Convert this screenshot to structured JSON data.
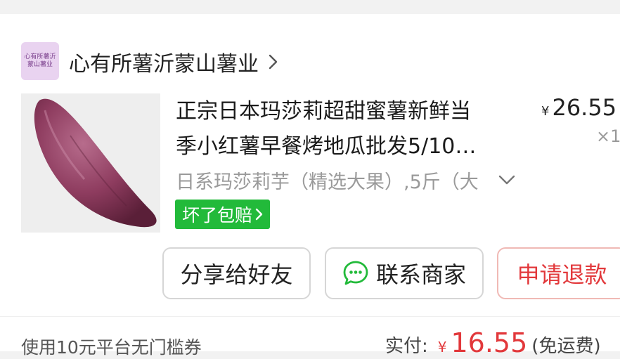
{
  "store": {
    "logo_text": "心有所薯沂蒙山薯业",
    "name": "心有所薯沂蒙山薯业"
  },
  "product": {
    "image_icon": "sweet-potato",
    "title_line1": "正宗日本玛莎莉超甜蜜薯新鲜当",
    "title_line2": "季小红薯早餐烤地瓜批发5/10…",
    "price_currency": "¥",
    "price": "26.55",
    "quantity": "×1",
    "spec": "日系玛莎莉芋（精选大果）,5斤（大",
    "guarantee_badge": "坏了包赔"
  },
  "actions": {
    "share": "分享给好友",
    "contact": "联系商家",
    "refund": "申请退款"
  },
  "footer": {
    "coupon_text": "使用10元平台无门槛券",
    "paid_label": "实付:",
    "paid_currency": "¥",
    "paid_amount": "16.55",
    "shipping_note": "(免运费)"
  },
  "colors": {
    "accent_red": "#e2383b",
    "badge_green": "#22ba3a",
    "chat_green": "#22ba3a"
  }
}
